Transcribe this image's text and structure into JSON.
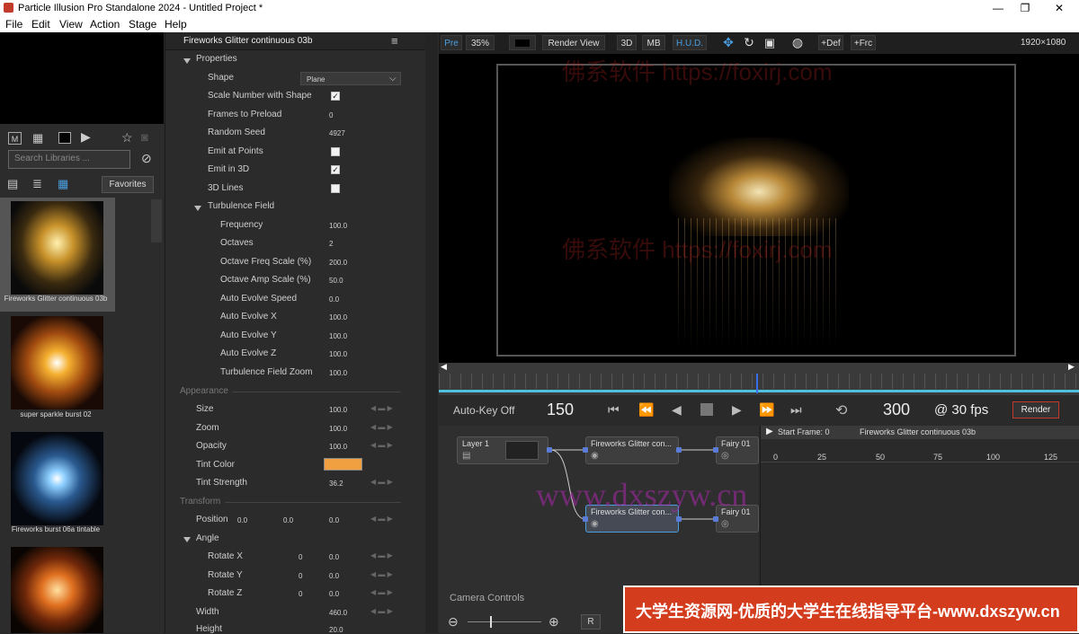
{
  "window": {
    "title": "Particle Illusion Pro Standalone 2024 - Untitled Project *",
    "minimize": "—",
    "maximize": "❐",
    "close": "✕"
  },
  "menu": [
    "File",
    "Edit",
    "View",
    "Action",
    "Stage",
    "Help"
  ],
  "library": {
    "search_placeholder": "Search Libraries ...",
    "favorites": "Favorites",
    "items": [
      {
        "caption": "Fireworks Glitter continuous 03b"
      },
      {
        "caption": "super sparkle burst 02"
      },
      {
        "caption": "Fireworks burst 06a tintable"
      },
      {
        "caption": ""
      }
    ]
  },
  "props": {
    "header": "Fireworks Glitter continuous 03b",
    "properties": "Properties",
    "shape_label": "Shape",
    "shape_value": "Plane",
    "scale_number_label": "Scale Number with Shape",
    "frames_preload_label": "Frames to Preload",
    "frames_preload_value": "0",
    "random_seed_label": "Random Seed",
    "random_seed_value": "4927",
    "emit_points_label": "Emit at Points",
    "emit_3d_label": "Emit in 3D",
    "lines_3d_label": "3D Lines",
    "turbulence_label": "Turbulence Field",
    "frequency_label": "Frequency",
    "frequency_value": "100.0",
    "octaves_label": "Octaves",
    "octaves_value": "2",
    "oct_freq_label": "Octave Freq Scale (%)",
    "oct_freq_value": "200.0",
    "oct_amp_label": "Octave Amp Scale (%)",
    "oct_amp_value": "50.0",
    "auto_speed_label": "Auto Evolve Speed",
    "auto_speed_value": "0.0",
    "auto_x_label": "Auto Evolve X",
    "auto_x_value": "100.0",
    "auto_y_label": "Auto Evolve Y",
    "auto_y_value": "100.0",
    "auto_z_label": "Auto Evolve Z",
    "auto_z_value": "100.0",
    "zoom_field_label": "Turbulence Field Zoom",
    "zoom_field_value": "100.0",
    "appearance": "Appearance",
    "size_label": "Size",
    "size_value": "100.0",
    "zoom_label": "Zoom",
    "zoom_value": "100.0",
    "opacity_label": "Opacity",
    "opacity_value": "100.0",
    "tint_color_label": "Tint Color",
    "tint_color": "#f0a040",
    "tint_strength_label": "Tint Strength",
    "tint_strength_value": "36.2",
    "transform": "Transform",
    "position_label": "Position",
    "pos_x": "0.0",
    "pos_y": "0.0",
    "pos_z": "0.0",
    "angle_label": "Angle",
    "rot_x_label": "Rotate X",
    "rot_x_a": "0",
    "rot_x_b": "0.0",
    "rot_y_label": "Rotate Y",
    "rot_y_a": "0",
    "rot_y_b": "0.0",
    "rot_z_label": "Rotate Z",
    "rot_z_a": "0",
    "rot_z_b": "0.0",
    "width_label": "Width",
    "width_value": "460.0",
    "height_label": "Height",
    "height_value": "20.0"
  },
  "viewer": {
    "pre": "Pre",
    "zoom": "35%",
    "render_view": "Render View",
    "b3d": "3D",
    "mb": "MB",
    "hud": "H.U.D.",
    "def": "+Def",
    "frc": "+Frc",
    "resolution": "1920×1080"
  },
  "transport": {
    "autokey": "Auto-Key Off",
    "current_frame": "150",
    "end_frame": "300",
    "fps": "@ 30 fps",
    "render": "Render"
  },
  "graph": {
    "layer": "Layer 1",
    "node1": "Fireworks Glitter con...",
    "node2": "Fireworks Glitter con...",
    "fairy1": "Fairy 01",
    "fairy2": "Fairy 01",
    "camera_controls": "Camera Controls",
    "r_button": "R"
  },
  "timeline2": {
    "start_frame": "Start Frame: 0",
    "emitter": "Fireworks Glitter continuous 03b",
    "ticks": [
      "0",
      "25",
      "50",
      "75",
      "100",
      "125"
    ]
  },
  "watermarks": {
    "a": "佛系软件 https://foxirj.com",
    "b": "www.dxszyw.cn",
    "c": "佛系软件 https://foxirj.com",
    "banner": "大学生资源网-优质的大学生在线指导平台-www.dxszyw.cn"
  }
}
